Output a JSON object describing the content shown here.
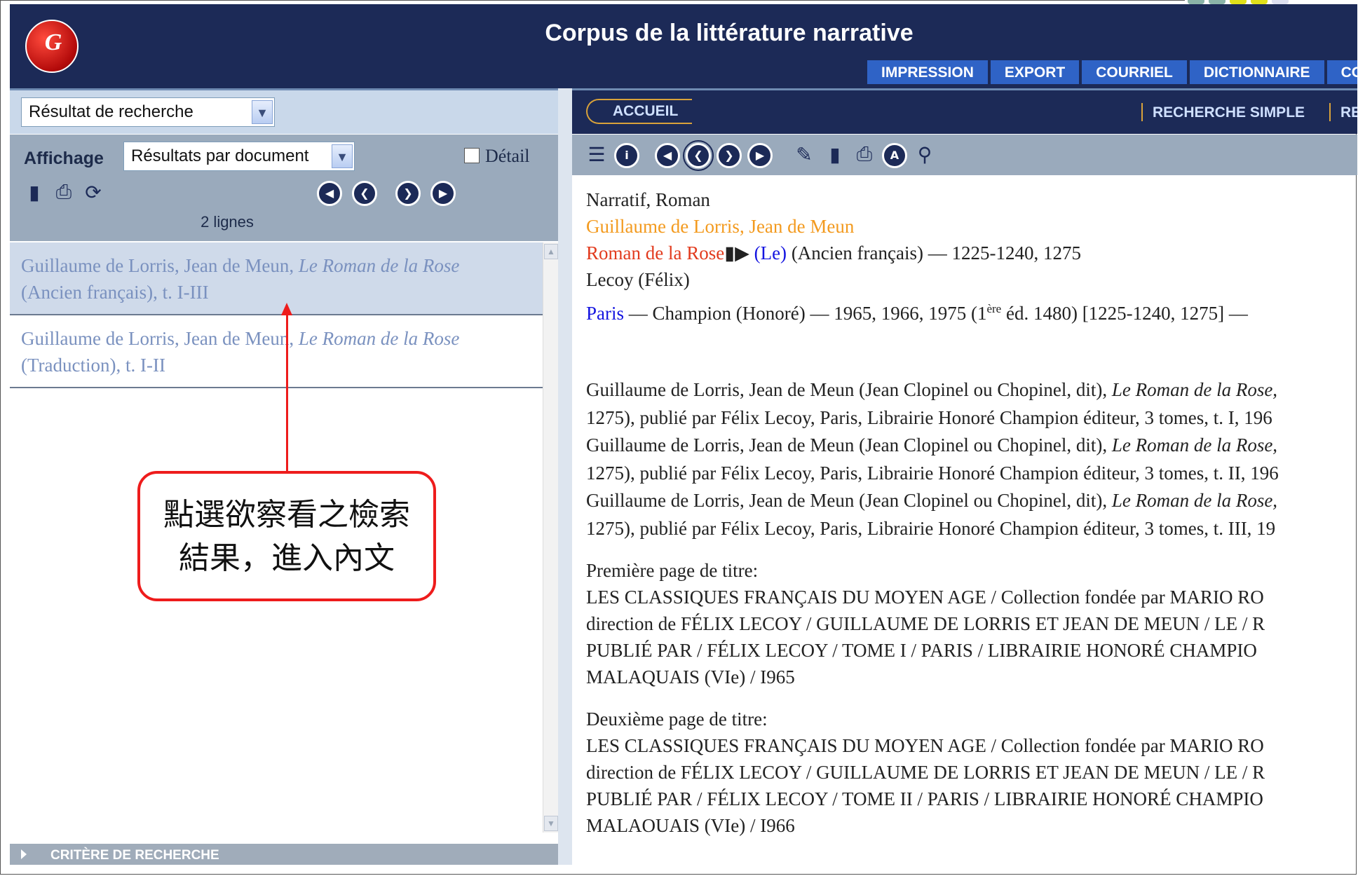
{
  "header": {
    "logo_text": "G",
    "title": "Corpus de la littérature narrative",
    "menu": [
      "IMPRESSION",
      "EXPORT",
      "COURRIEL",
      "DICTIONNAIRE",
      "CO"
    ]
  },
  "left": {
    "view_select": "Résultat de recherche",
    "affichage_label": "Affichage",
    "display_select": "Résultats par document",
    "detail_label": "Détail",
    "lines_count": "2 lignes",
    "results": [
      {
        "authors": "Guillaume de Lorris, Jean de Meun, ",
        "title": "Le Roman de la Rose",
        "suffix": "(Ancien français), t. I-III"
      },
      {
        "authors": "Guillaume de Lorris, Jean de Meun, ",
        "title": "Le Roman de la Rose",
        "suffix": "(Traduction), t. I-II"
      }
    ],
    "criteria": "CRITÈRE DE RECHERCHE"
  },
  "right": {
    "accueil": "ACCUEIL",
    "links": [
      "RECHERCHE SIMPLE",
      "RE"
    ],
    "content": {
      "genre": "Narratif, Roman",
      "authors": "Guillaume de Lorris, Jean de Meun",
      "title_red": "Roman de la Rose",
      "title_blue": "(Le)",
      "title_rest": " (Ancien français) — 1225-1240, 1275",
      "editor": "Lecoy (Félix)",
      "place": "Paris",
      "pub_a": " — Champion (Honoré) — 1965, 1966, 1975 (1",
      "pub_sup": "ère",
      "pub_b": " éd. 1480) [1225-1240, 1275] —",
      "refs": [
        {
          "a": "Guillaume de Lorris, Jean de Meun (Jean Clopinel ou Chopinel, dit), ",
          "i": "Le Roman de la Rose,",
          "b": "1275), publié par Félix Lecoy, Paris, Librairie Honoré Champion éditeur, 3 tomes, t. I, 196"
        },
        {
          "a": "Guillaume de Lorris, Jean de Meun (Jean Clopinel ou Chopinel, dit), ",
          "i": "Le Roman de la Rose,",
          "b": "1275), publié par Félix Lecoy, Paris, Librairie Honoré Champion éditeur, 3 tomes, t. II, 196"
        },
        {
          "a": "Guillaume de Lorris, Jean de Meun (Jean Clopinel ou Chopinel, dit), ",
          "i": "Le Roman de la Rose,",
          "b": "1275), publié par Félix Lecoy, Paris, Librairie Honoré Champion éditeur, 3 tomes, t. III, 19"
        }
      ],
      "first_title_label": "Première page de titre:",
      "first_title_lines": [
        "LES CLASSIQUES FRANÇAIS DU MOYEN AGE / Collection fondée par MARIO RO",
        "direction de FÉLIX LECOY / GUILLAUME DE LORRIS ET JEAN DE MEUN / LE / R",
        "PUBLIÉ PAR / FÉLIX LECOY / TOME I / PARIS / LIBRAIRIE HONORÉ CHAMPIO",
        "MALAQUAIS (VIe) / I965"
      ],
      "second_title_label": "Deuxième page de titre:",
      "second_title_lines": [
        "LES CLASSIQUES FRANÇAIS DU MOYEN AGE / Collection fondée par MARIO RO",
        "direction de FÉLIX LECOY / GUILLAUME DE LORRIS ET JEAN DE MEUN / LE / R",
        "PUBLIÉ PAR / FÉLIX LECOY / TOME II / PARIS / LIBRAIRIE HONORÉ CHAMPIO",
        "MALAOUAIS (VIe) / I966"
      ]
    }
  },
  "annotation": {
    "line1": "點選欲察看之檢索",
    "line2": "結果，進入內文"
  },
  "colors": {
    "header_bg": "#1c2a57",
    "menu_bg": "#2f63c6",
    "result_text": "#7a91bf",
    "callout_border": "#ee1c1c",
    "author_orange": "#f39a1e",
    "title_red": "#e23b1e",
    "link_blue": "#1414e0"
  },
  "icons": [
    "logo-icon",
    "sheet-icon",
    "print-icon",
    "refresh-icon",
    "first-page-icon",
    "prev-page-icon",
    "next-page-icon",
    "last-page-icon",
    "books-icon",
    "info-icon",
    "edit-icon",
    "bookmark-icon",
    "fax-icon",
    "accent-icon",
    "search-doc-icon"
  ]
}
